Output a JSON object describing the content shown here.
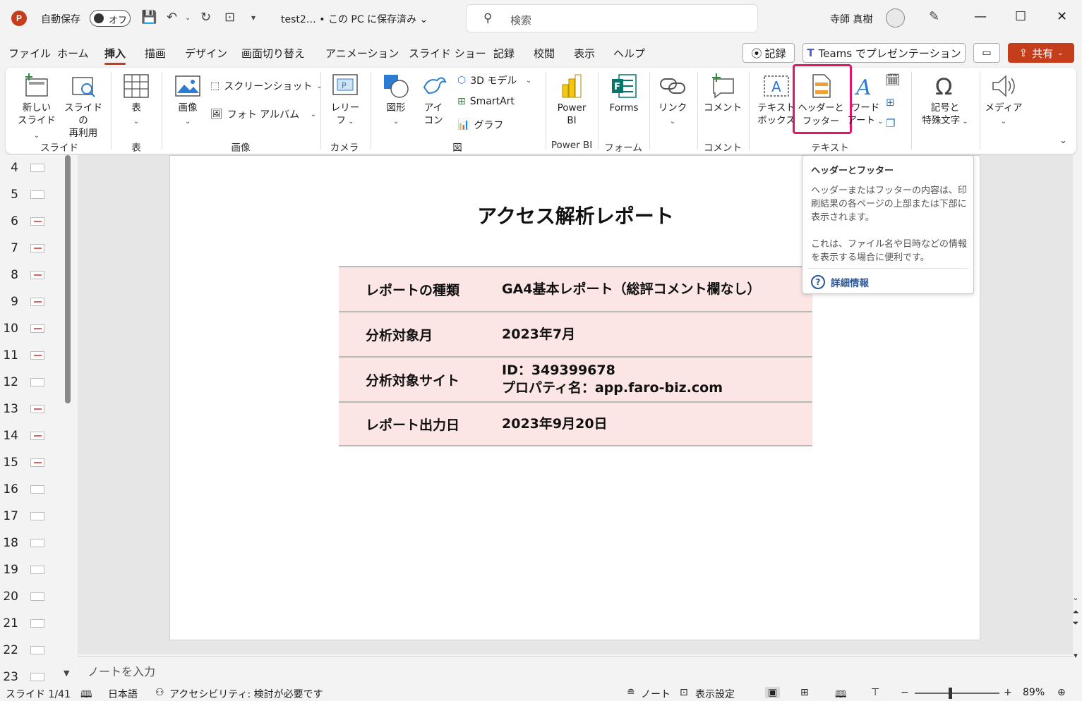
{
  "titlebar": {
    "autosave_label": "自動保存",
    "autosave_state": "オフ",
    "doc_title": "test2…  • この PC に保存済み ⌄",
    "search_placeholder": "検索",
    "user_name": "寺師 真樹"
  },
  "tabs": [
    "ファイル",
    "ホーム",
    "挿入",
    "描画",
    "デザイン",
    "画面切り替え",
    "アニメーション",
    "スライド ショー",
    "記録",
    "校閲",
    "表示",
    "ヘルプ"
  ],
  "active_tab": "挿入",
  "tab_actions": {
    "record": "記録",
    "teams": "Teams でプレゼンテーション",
    "share": "共有"
  },
  "ribbon": {
    "new_slide": "新しい\nスライド",
    "reuse_slide": "スライドの\n再利用",
    "table": "表",
    "image": "画像",
    "screenshot": "スクリーンショット",
    "photo_album": "フォト アルバム",
    "cameo": "レリー\nフ",
    "shapes": "図形",
    "icons": "アイ\nコン",
    "model3d": "3D モデル",
    "smartart": "SmartArt",
    "chart": "グラフ",
    "powerbi": "Power\nBI",
    "forms": "Forms",
    "link": "リンク",
    "comment": "コメント",
    "textbox": "テキスト\nボックス",
    "header_footer": "ヘッダーと\nフッター",
    "wordart": "ワード\nアート",
    "symbols": "記号と\n特殊文字",
    "media": "メディア",
    "groups": {
      "slides": "スライド",
      "tables": "表",
      "images": "画像",
      "camera": "カメラ",
      "illustrations": "図",
      "powerbi": "Power BI",
      "forms": "フォーム",
      "comments": "コメント",
      "text": "テキスト"
    }
  },
  "thumbnails": [
    "4",
    "5",
    "6",
    "7",
    "8",
    "9",
    "10",
    "11",
    "12",
    "13",
    "14",
    "15",
    "16",
    "17",
    "18",
    "19",
    "20",
    "21",
    "22",
    "23"
  ],
  "slide": {
    "title": "アクセス解析レポート",
    "rows": [
      {
        "label": "レポートの種類",
        "value": "GA4基本レポート（総評コメント欄なし）",
        "value2": ""
      },
      {
        "label": "分析対象月",
        "value": "2023年7月",
        "value2": ""
      },
      {
        "label": "分析対象サイト",
        "value": "ID：349399678",
        "value2": "プロパティ名：app.faro-biz.com"
      },
      {
        "label": "レポート出力日",
        "value": "2023年9月20日",
        "value2": ""
      }
    ]
  },
  "notes_placeholder": "ノートを入力",
  "tooltip": {
    "title": "ヘッダーとフッター",
    "body1": "ヘッダーまたはフッターの内容は、印刷結果の各ページの上部または下部に表示されます。",
    "body2": "これは、ファイル名や日時などの情報を表示する場合に便利です。",
    "link": "詳細情報"
  },
  "statusbar": {
    "slide_pos": "スライド 1/41",
    "language": "日本語",
    "accessibility": "アクセシビリティ: 検討が必要です",
    "notes": "ノート",
    "display_settings": "表示設定",
    "zoom": "89%"
  },
  "colors": {
    "accent": "#c43e1c",
    "highlight": "#e0156d",
    "table_fill": "#fbe6e5"
  }
}
